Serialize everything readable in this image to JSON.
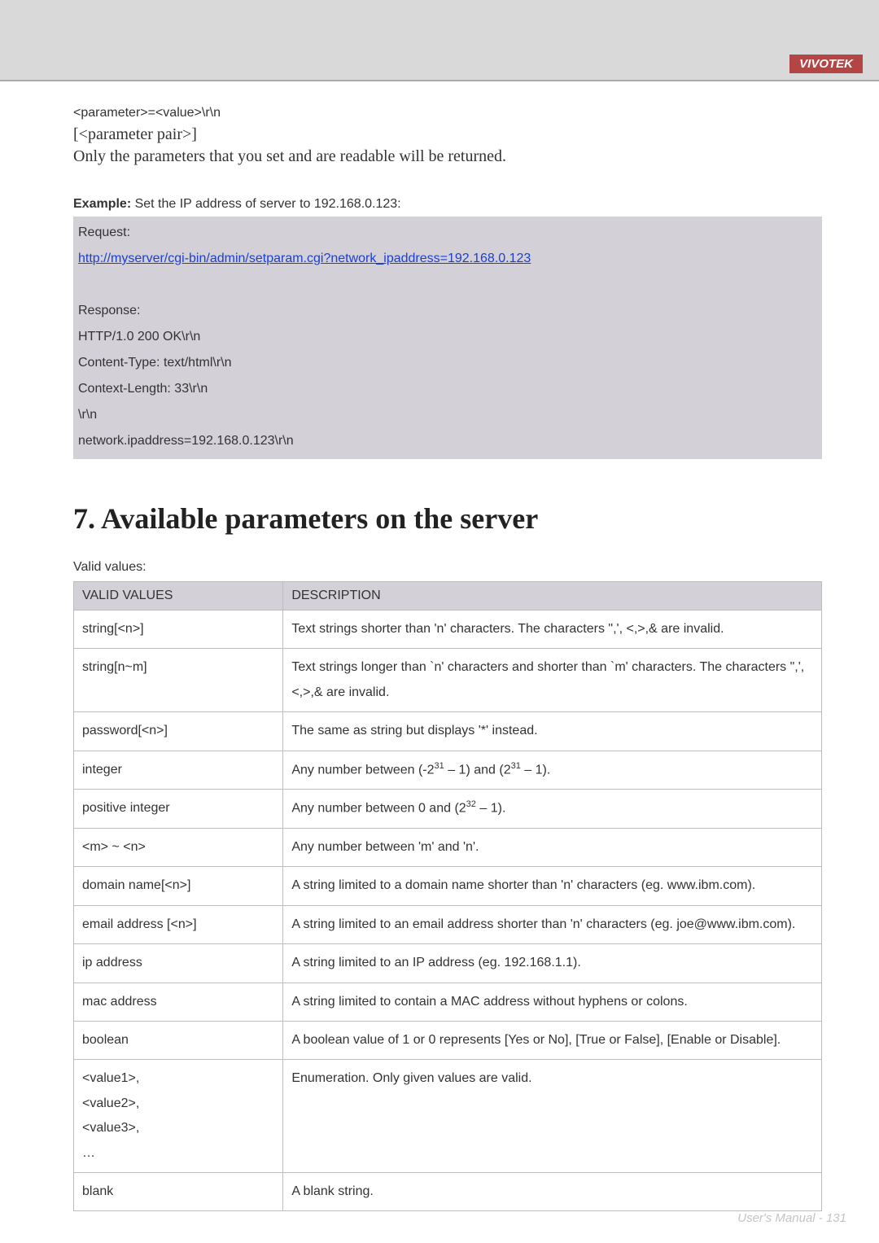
{
  "header": {
    "brand": "VIVOTEK"
  },
  "intro": {
    "line1": "<parameter>=<value>\\r\\n",
    "line2": "[<parameter pair>]",
    "line3": "Only the parameters that you set and are readable will be returned."
  },
  "example": {
    "label_bold": "Example:",
    "label_rest": " Set the IP address of server to 192.168.0.123:",
    "block": {
      "request": "Request:",
      "url": "http://myserver/cgi-bin/admin/setparam.cgi?network_ipaddress=192.168.0.123",
      "response": "Response:",
      "r1": "HTTP/1.0 200 OK\\r\\n",
      "r2": "Content-Type: text/html\\r\\n",
      "r3": "Context-Length: 33\\r\\n",
      "r4": "\\r\\n",
      "r5": "network.ipaddress=192.168.0.123\\r\\n"
    }
  },
  "section_title": "7. Available parameters on the server",
  "valid_label": "Valid values:",
  "table": {
    "head": {
      "c1": "VALID VALUES",
      "c2": "DESCRIPTION"
    },
    "rows": [
      {
        "c1": "string[<n>]",
        "c2": "Text strings shorter than 'n' characters. The characters \",', <,>,& are invalid."
      },
      {
        "c1": "string[n~m]",
        "c2": "Text strings longer than `n' characters and shorter than `m' characters. The characters \",', <,>,& are invalid."
      },
      {
        "c1": "password[<n>]",
        "c2": "The same as string but displays '*' instead."
      },
      {
        "c1": "integer",
        "c2": ""
      },
      {
        "c1": "positive integer",
        "c2": ""
      },
      {
        "c1": "<m> ~ <n>",
        "c2": "Any number between 'm' and 'n'."
      },
      {
        "c1": "domain name[<n>]",
        "c2": "A string limited to a domain name shorter than 'n' characters (eg. www.ibm.com)."
      },
      {
        "c1": "email address [<n>]",
        "c2": "A string limited to an email address shorter than 'n' characters (eg. joe@www.ibm.com)."
      },
      {
        "c1": "ip address",
        "c2": "A string limited to an IP address (eg. 192.168.1.1)."
      },
      {
        "c1": "mac address",
        "c2": "A string limited to contain a MAC address without hyphens or colons."
      },
      {
        "c1": "boolean",
        "c2": "A boolean value of 1 or 0 represents [Yes or No], [True or False], [Enable or Disable]."
      },
      {
        "c1": "<value1>,\n<value2>,\n<value3>,\n…",
        "c2": "Enumeration. Only given values are valid."
      },
      {
        "c1": "blank",
        "c2": "A blank string."
      }
    ],
    "integer_desc_prefix": "Any number between (-2",
    "integer_desc_mid": " – 1) and (2",
    "integer_desc_suffix": " – 1).",
    "posint_desc_prefix": "Any number between 0 and (2",
    "posint_desc_suffix": " – 1).",
    "exp31": "31",
    "exp32": "32"
  },
  "footer": "User's Manual - 131"
}
